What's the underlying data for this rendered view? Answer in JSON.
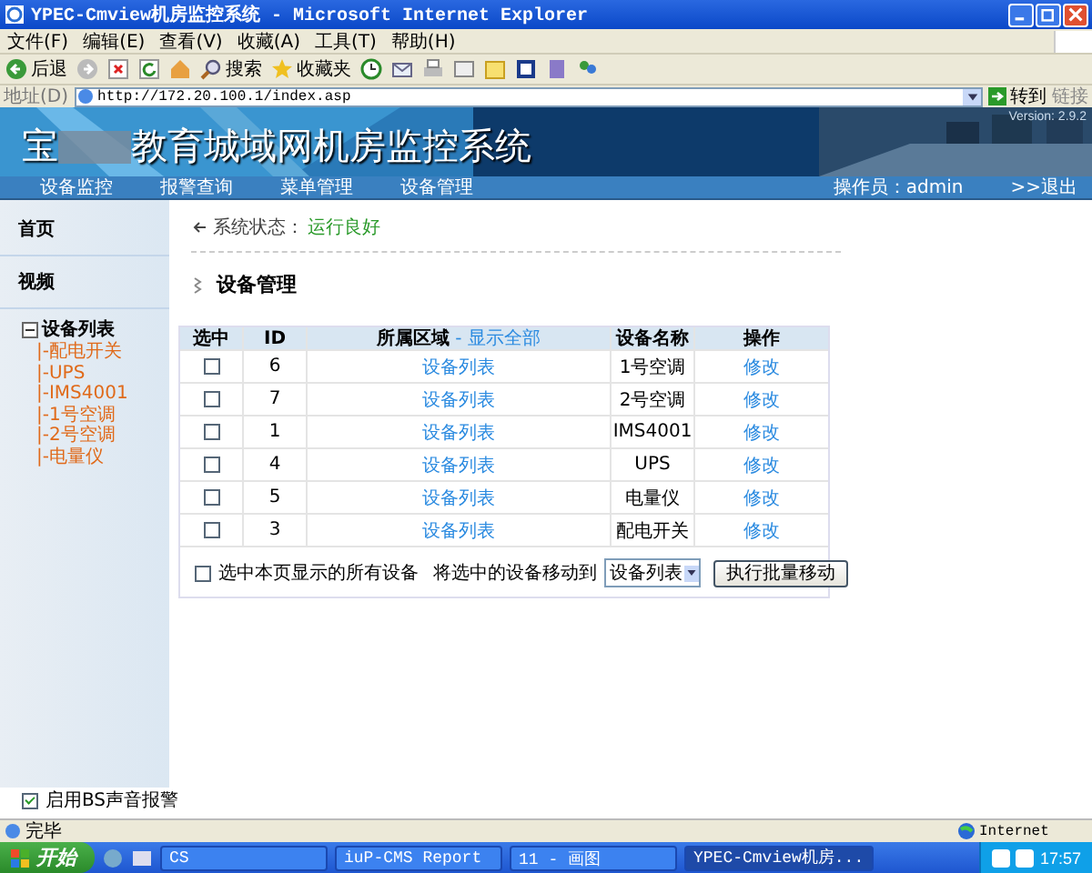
{
  "window": {
    "title": "YPEC-Cmview机房监控系统 - Microsoft Internet Explorer"
  },
  "menu": [
    "文件(F)",
    "编辑(E)",
    "查看(V)",
    "收藏(A)",
    "工具(T)",
    "帮助(H)"
  ],
  "toolbar": {
    "back": "后退",
    "search": "搜索",
    "favorites": "收藏夹"
  },
  "address": {
    "label": "地址(D)",
    "value": "http://172.20.100.1/index.asp",
    "go": "转到",
    "links": "链接"
  },
  "banner": {
    "title_start": "宝",
    "title_end": "教育城域网机房监控系统",
    "version": "Version: 2.9.2"
  },
  "nav": {
    "items": [
      "设备监控",
      "报警查询",
      "菜单管理",
      "设备管理"
    ],
    "operator": "操作员：admin",
    "logout": ">>退出"
  },
  "sidebar": {
    "items": [
      "首页",
      "视频"
    ],
    "tree": {
      "label": "设备列表",
      "expanded": true,
      "children": [
        "|-配电开关",
        "|-UPS",
        "|-IMS4001",
        "|-1号空调",
        "|-2号空调",
        "|-电量仪"
      ]
    }
  },
  "status": {
    "label": "系统状态：",
    "value": "运行良好"
  },
  "section_title": "设备管理",
  "table": {
    "columns": [
      "选中",
      "ID",
      "所属区域",
      "设备名称",
      "操作"
    ],
    "show_all": "- 显示全部",
    "rows": [
      {
        "checked": false,
        "id": "6",
        "area": "设备列表",
        "name": "1号空调",
        "action": "修改"
      },
      {
        "checked": false,
        "id": "7",
        "area": "设备列表",
        "name": "2号空调",
        "action": "修改"
      },
      {
        "checked": false,
        "id": "1",
        "area": "设备列表",
        "name": "IMS4001",
        "action": "修改"
      },
      {
        "checked": false,
        "id": "4",
        "area": "设备列表",
        "name": "UPS",
        "action": "修改"
      },
      {
        "checked": false,
        "id": "5",
        "area": "设备列表",
        "name": "电量仪",
        "action": "修改"
      },
      {
        "checked": false,
        "id": "3",
        "area": "设备列表",
        "name": "配电开关",
        "action": "修改"
      }
    ]
  },
  "footer": {
    "select_all": {
      "label": "选中本页显示的所有设备",
      "checked": false
    },
    "move_label": "将选中的设备移动到",
    "target": "设备列表",
    "button": "执行批量移动"
  },
  "sound_alarm": {
    "label": "启用BS声音报警",
    "checked": true
  },
  "status_bar": {
    "text": "完毕",
    "zone": "Internet"
  },
  "taskbar": {
    "start": "开始",
    "tasks": [
      {
        "label": "CS",
        "selected": false
      },
      {
        "label": "iuP-CMS Report",
        "selected": false
      },
      {
        "label": "11 - 画图",
        "selected": false
      },
      {
        "label": "YPEC-Cmview机房...",
        "selected": true
      }
    ],
    "clock": "17:57"
  }
}
